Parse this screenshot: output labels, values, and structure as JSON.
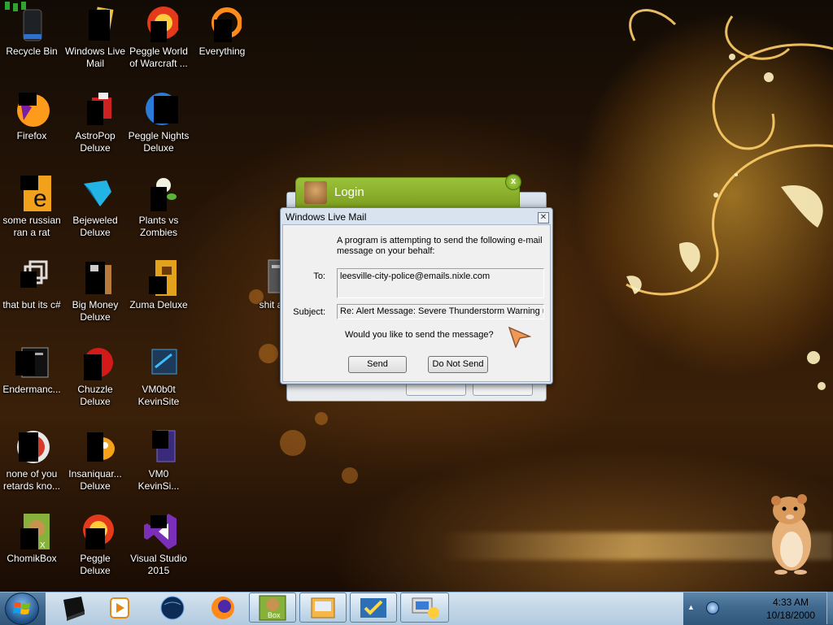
{
  "desktop": {
    "icons": [
      {
        "label": "Recycle Bin",
        "icon": "recycle-bin-icon"
      },
      {
        "label": "Windows Live Mail",
        "icon": "mail-icon"
      },
      {
        "label": "Peggle World of Warcraft ...",
        "icon": "peggle-icon"
      },
      {
        "label": "Everything",
        "icon": "search-icon"
      },
      {
        "label": "Firefox",
        "icon": "firefox-icon"
      },
      {
        "label": "AstroPop Deluxe",
        "icon": "game-icon"
      },
      {
        "label": "Peggle Nights Deluxe",
        "icon": "peggle-icon"
      },
      {
        "label": "some russian ran a rat",
        "icon": "folder-icon"
      },
      {
        "label": "Bejeweled Deluxe",
        "icon": "gem-icon"
      },
      {
        "label": "Plants vs Zombies",
        "icon": "plant-icon"
      },
      {
        "label": "that but its c#",
        "icon": "shortcut-icon"
      },
      {
        "label": "Big Money Deluxe",
        "icon": "game-icon"
      },
      {
        "label": "Zuma Deluxe",
        "icon": "zuma-icon"
      },
      {
        "label": "Endermanc...",
        "icon": "terminal-icon"
      },
      {
        "label": "Chuzzle Deluxe",
        "icon": "game-icon"
      },
      {
        "label": "VM0b0t KevinSite",
        "icon": "folder-icon"
      },
      {
        "label": "none of you retards kno...",
        "icon": "chrome-icon"
      },
      {
        "label": "Insaniquar... Deluxe",
        "icon": "fish-icon"
      },
      {
        "label": "VM0 KevinSi...",
        "icon": "document-icon"
      },
      {
        "label": "ChomikBox",
        "icon": "chomikbox-icon"
      },
      {
        "label": "Peggle Deluxe",
        "icon": "peggle-icon"
      },
      {
        "label": "Visual Studio 2015",
        "icon": "visual-studio-icon"
      },
      {
        "label": "shit aske",
        "icon": "file-icon"
      }
    ]
  },
  "login_window": {
    "title": "Login",
    "close_symbol": "x"
  },
  "dialog": {
    "title": "Windows Live Mail",
    "close_symbol": "✕",
    "intro": "A program is attempting to send the following e-mail message on your behalf:",
    "to_label": "To:",
    "to_value": "leesville-city-police@emails.nixle.com",
    "subject_label": "Subject:",
    "subject_value": "Re: Alert Message: Severe Thunderstorm Warning ur",
    "question": "Would you like to send the message?",
    "send_label": "Send",
    "do_not_send_label": "Do Not Send"
  },
  "taskbar": {
    "items": [
      "folder-icon",
      "media-player-icon",
      "globe-icon",
      "firefox-icon",
      "chomikbox-icon",
      "mail-icon",
      "security-icon",
      "computer-icon"
    ],
    "clock_time": "4:33 AM",
    "clock_date": "10/18/2000",
    "tray_arrow": "▲"
  },
  "colors": {
    "login_green": "#8db22b",
    "dialog_frame": "#d9e3ef",
    "taskbar_blue": "#41698f"
  }
}
